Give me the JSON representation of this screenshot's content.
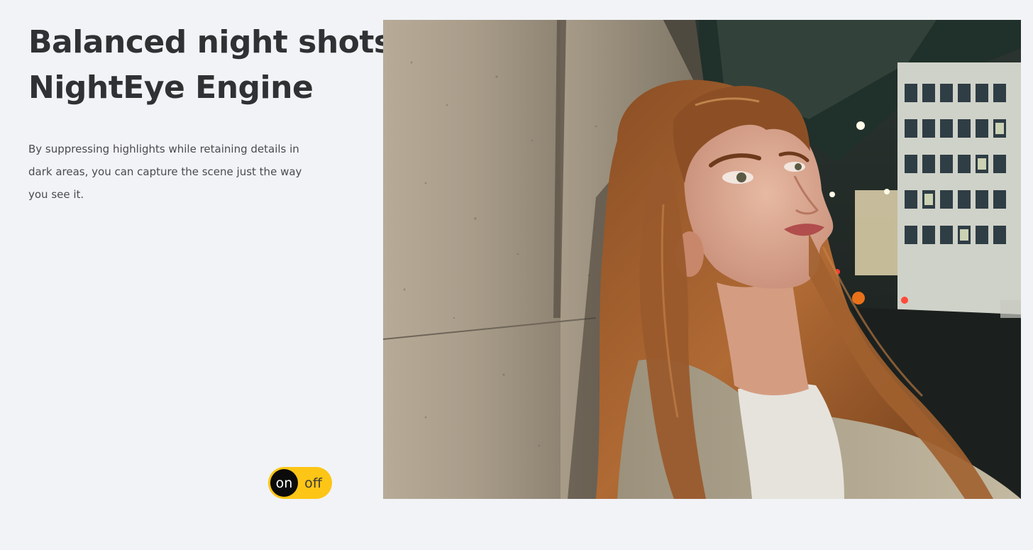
{
  "hero": {
    "headline_line1": "Balanced night shots.",
    "headline_line2": "NightEye Engine",
    "description": "By suppressing highlights while retaining details in dark areas, you can capture the scene just the way you see it."
  },
  "toggle": {
    "on_label": "on",
    "off_label": "off",
    "state": "on",
    "track_color": "#fdc515",
    "knob_color": "#0b0b0b"
  },
  "photo": {
    "subject": "night-portrait-sample-photo"
  },
  "colors": {
    "background": "#f2f3f7",
    "headline": "#303133",
    "body": "#4a4b4f"
  }
}
